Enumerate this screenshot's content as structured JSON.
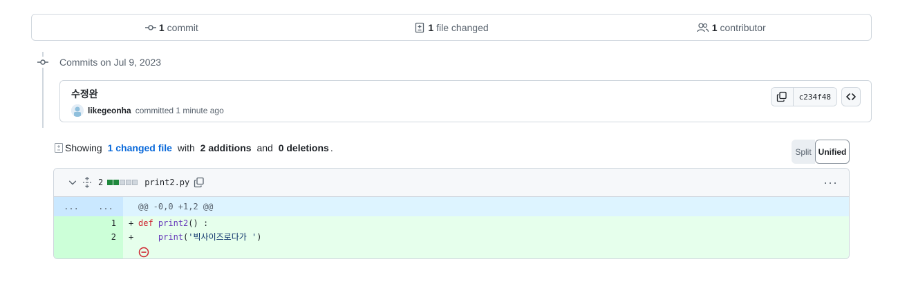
{
  "stats": {
    "commits_count": "1",
    "commits_label": "commit",
    "files_count": "1",
    "files_label": "file changed",
    "contributors_count": "1",
    "contributors_label": "contributor"
  },
  "timeline": {
    "heading": "Commits on Jul 9, 2023"
  },
  "commit": {
    "title": "수정완",
    "author": "likegeonha",
    "action": "committed 1 minute ago",
    "sha": "c234f48"
  },
  "summary": {
    "prefix": "Showing",
    "changed_link": "1 changed file",
    "with": "with",
    "additions": "2 additions",
    "and": "and",
    "deletions": "0 deletions",
    "period": "."
  },
  "view_toggle": {
    "split": "Split",
    "unified": "Unified",
    "selected": "Unified"
  },
  "file": {
    "changes_count": "2",
    "name": "print2.py",
    "hunk": {
      "old_marker": "...",
      "new_marker": "...",
      "header": "@@ -0,0 +1,2 @@"
    },
    "lines": [
      {
        "new_num": "1",
        "sign": "+",
        "kw": "def",
        "fn": "print2",
        "rest": "() :"
      },
      {
        "new_num": "2",
        "sign": "+",
        "indent": "    ",
        "fn": "print",
        "open": "(",
        "str": "'빅사이즈로다가 '",
        "close": ")"
      }
    ]
  },
  "colors": {
    "accent": "#0969da",
    "add_bg": "#e6ffec",
    "add_num_bg": "#ccffd8",
    "hunk_bg": "#ddf4ff",
    "diffstat_add": "#1f883d",
    "error": "#cf222e"
  },
  "icons": [
    "commit-icon",
    "file-diff-icon",
    "people-icon",
    "copy-icon",
    "code-icon",
    "chevron-down-icon",
    "expand-icon",
    "kebab-icon",
    "no-entry-icon"
  ]
}
